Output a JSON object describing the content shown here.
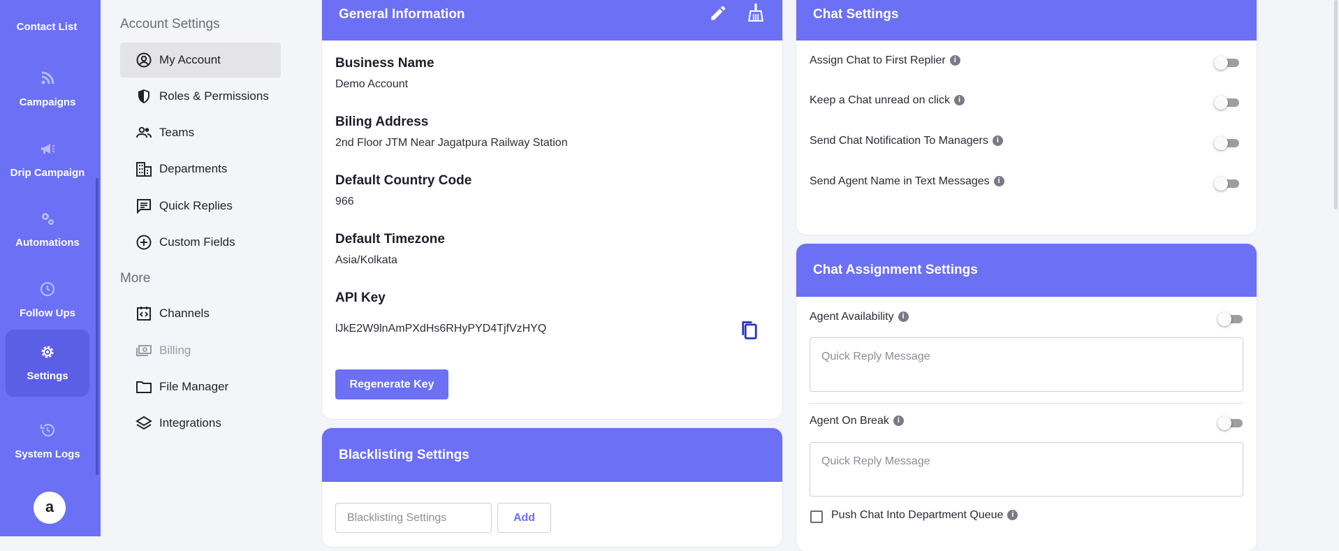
{
  "rail": {
    "top_label": "Contact List",
    "items": [
      {
        "label": "Campaigns",
        "icon": "rss-icon"
      },
      {
        "label": "Drip Campaign",
        "icon": "megaphone-icon"
      },
      {
        "label": "Automations",
        "icon": "gears-icon"
      },
      {
        "label": "Follow Ups",
        "icon": "clock-icon"
      },
      {
        "label": "Settings",
        "icon": "gear-icon"
      },
      {
        "label": "System Logs",
        "icon": "history-icon"
      }
    ],
    "avatar_letter": "a"
  },
  "submenu": {
    "account_heading": "Account Settings",
    "more_heading": "More",
    "items": [
      {
        "label": "My Account"
      },
      {
        "label": "Roles & Permissions"
      },
      {
        "label": "Teams"
      },
      {
        "label": "Departments"
      },
      {
        "label": "Quick Replies"
      },
      {
        "label": "Custom Fields"
      },
      {
        "label": "Channels"
      },
      {
        "label": "Billing"
      },
      {
        "label": "File Manager"
      },
      {
        "label": "Integrations"
      }
    ]
  },
  "general": {
    "title": "General Information",
    "business_name_label": "Business Name",
    "business_name": "Demo Account",
    "billing_address_label": "Biling Address",
    "billing_address": "2nd Floor JTM Near Jagatpura Railway Station",
    "country_code_label": "Default Country Code",
    "country_code": "966",
    "timezone_label": "Default Timezone",
    "timezone": "Asia/Kolkata",
    "api_key_label": "API Key",
    "api_key": "lJkE2W9lnAmPXdHs6RHyPYD4TjfVzHYQ",
    "regenerate_label": "Regenerate Key"
  },
  "blacklisting": {
    "title": "Blacklisting Settings",
    "input_placeholder": "Blacklisting Settings",
    "add_label": "Add"
  },
  "chat_settings": {
    "title": "Chat Settings",
    "toggles": [
      {
        "label": "Assign Chat to First Replier",
        "on": false
      },
      {
        "label": "Keep a Chat unread on click",
        "on": false
      },
      {
        "label": "Send Chat Notification To Managers",
        "on": false
      },
      {
        "label": "Send Agent Name in Text Messages",
        "on": false
      }
    ]
  },
  "assignment": {
    "title": "Chat Assignment Settings",
    "availability_label": "Agent Availability",
    "availability_placeholder": "Quick Reply Message",
    "break_label": "Agent On Break",
    "break_placeholder": "Quick Reply Message",
    "queue_label": "Push Chat Into Department Queue"
  },
  "colors": {
    "accent": "#6b70f5",
    "active_rail": "#5a5fe6"
  }
}
